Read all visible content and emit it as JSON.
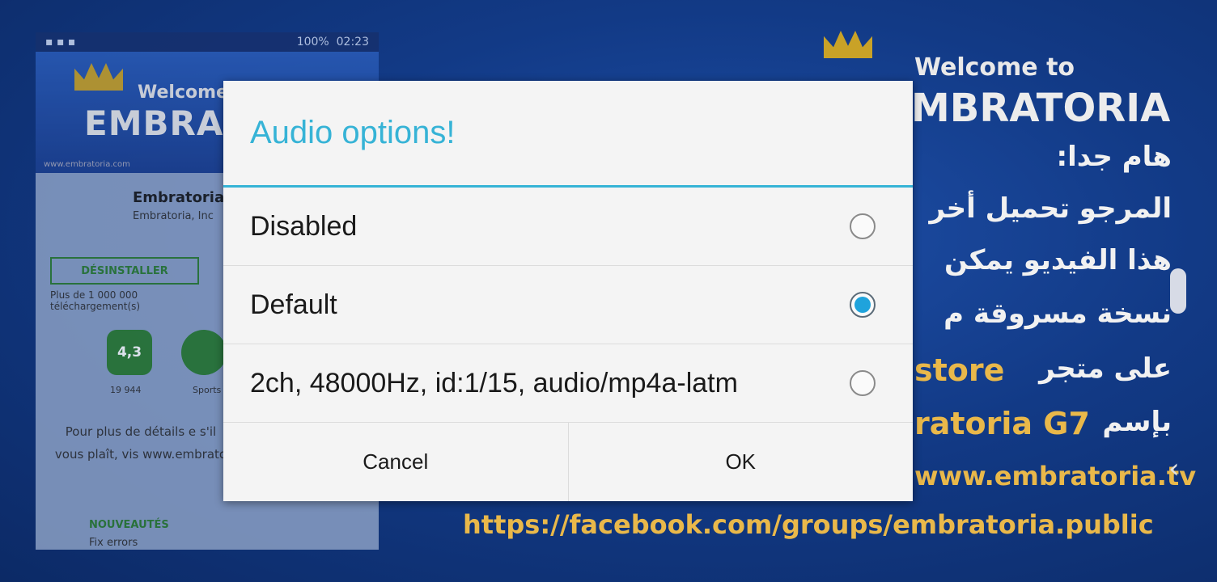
{
  "background": {
    "phone": {
      "status_time": "02:23",
      "status_battery": "100%",
      "banner_welcome": "Welcome to",
      "banner_brand": "EMBRA",
      "banner_url": "www.embratoria.com",
      "app_name": "Embratoria",
      "app_dev": "Embratoria, Inc",
      "uninstall_label": "DÉSINSTALLER",
      "downloads": "Plus de 1 000 000 téléchargement(s)",
      "rating": "4,3",
      "rating_count": "19 944",
      "category": "Sports",
      "details": "Pour plus de détails e s'il vous plaît, vis www.embrato",
      "news_title": "NOUVEAUTÉS",
      "news_text": "Fix errors"
    },
    "poster": {
      "welcome": "Welcome to",
      "brand": "MBRATORIA",
      "arabic_lines": [
        "هام جدا:",
        "المرجو تحميل أخر",
        "هذا الفيديو يمكن",
        "نسخة مسروقة م",
        "على متجر",
        "بإسم"
      ],
      "store": "store",
      "g7": "ratoria G7",
      "tv": "www.embratoria.tv",
      "facebook": "https://facebook.com/groups/embratoria.public"
    }
  },
  "dialog": {
    "title": "Audio options!",
    "options": [
      {
        "label": "Disabled",
        "selected": false
      },
      {
        "label": "Default",
        "selected": true
      },
      {
        "label": "2ch, 48000Hz, id:1/15, audio/mp4a-latm",
        "selected": false
      }
    ],
    "cancel_label": "Cancel",
    "ok_label": "OK"
  },
  "colors": {
    "accent": "#36b3d6",
    "radio_selected": "#1fa3dc",
    "dialog_bg": "#f4f4f4"
  }
}
